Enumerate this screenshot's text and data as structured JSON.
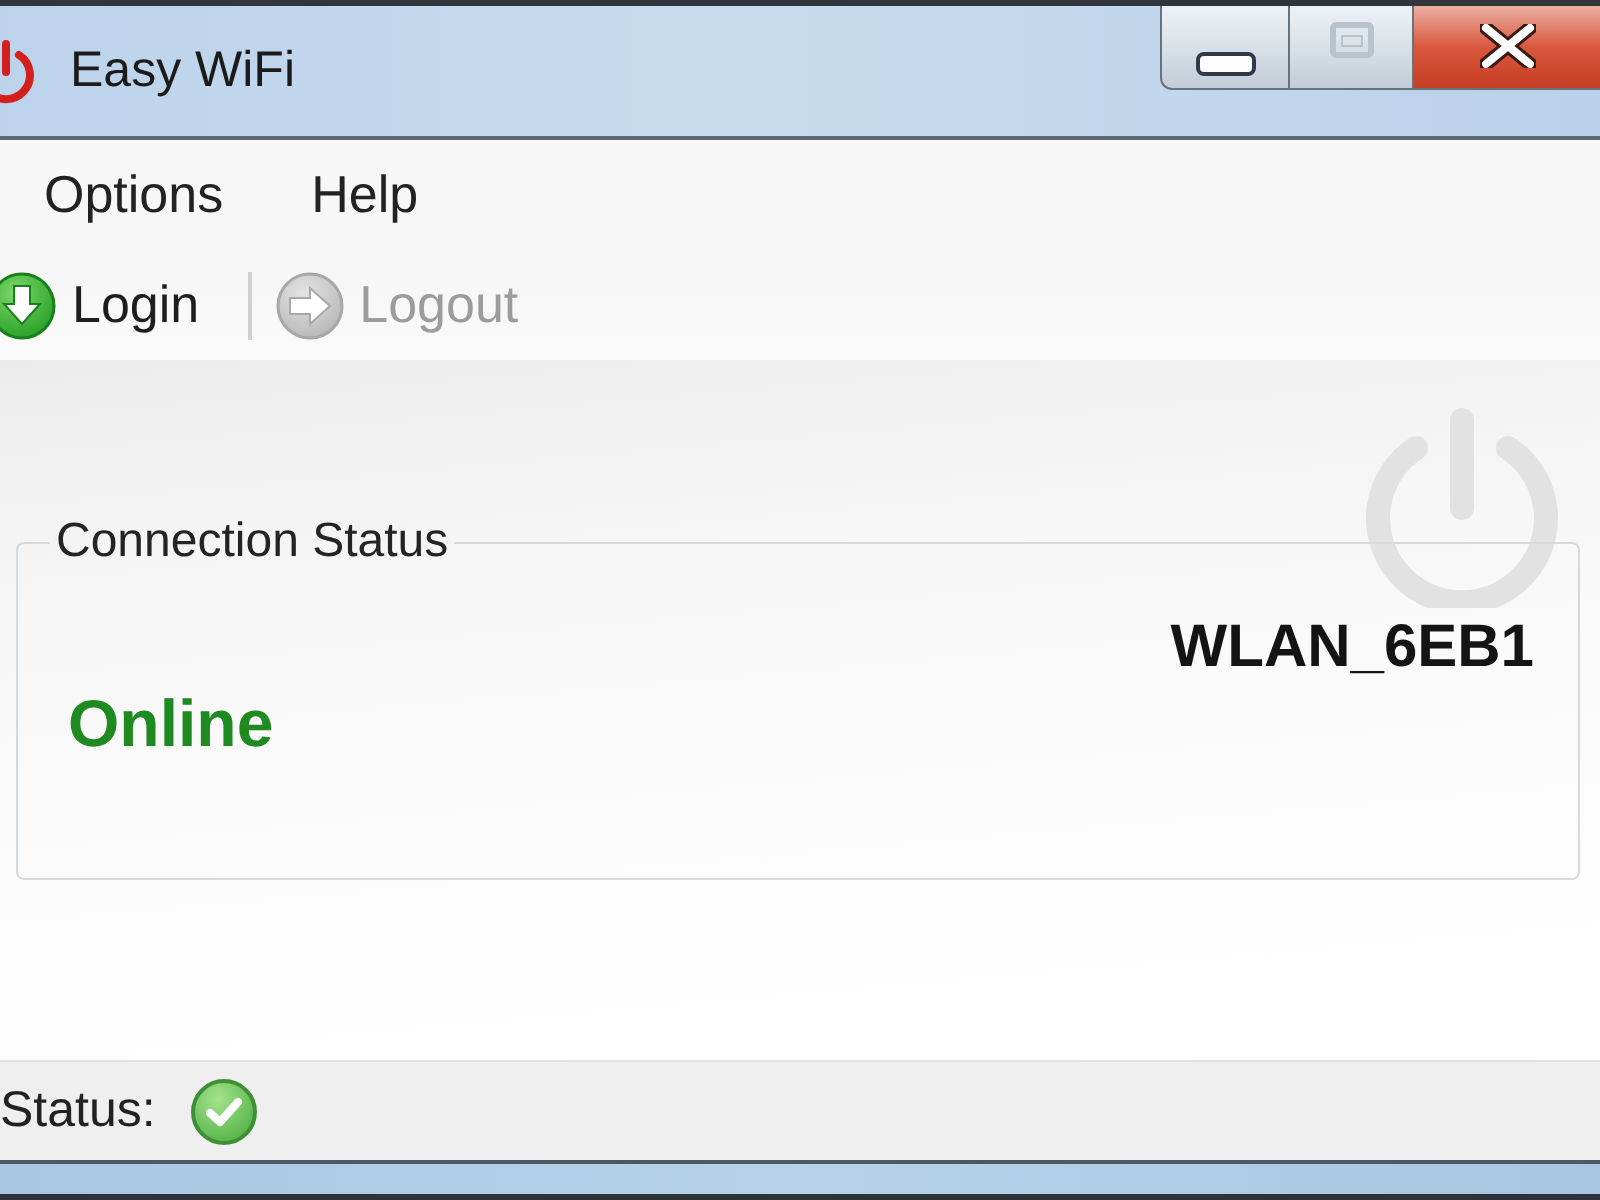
{
  "window": {
    "title": "Easy WiFi",
    "maximize_disabled": true
  },
  "menu": [
    {
      "label": "Options"
    },
    {
      "label": "Help"
    }
  ],
  "toolbar": [
    {
      "label": "Login",
      "kind": "login",
      "disabled": false
    },
    {
      "label": "Logout",
      "kind": "logout",
      "disabled": true
    }
  ],
  "connection_status": {
    "title": "Connection Status",
    "network": "WLAN_6EB1",
    "state": "Online"
  },
  "status_bar": {
    "label": "Status:",
    "online": true
  }
}
